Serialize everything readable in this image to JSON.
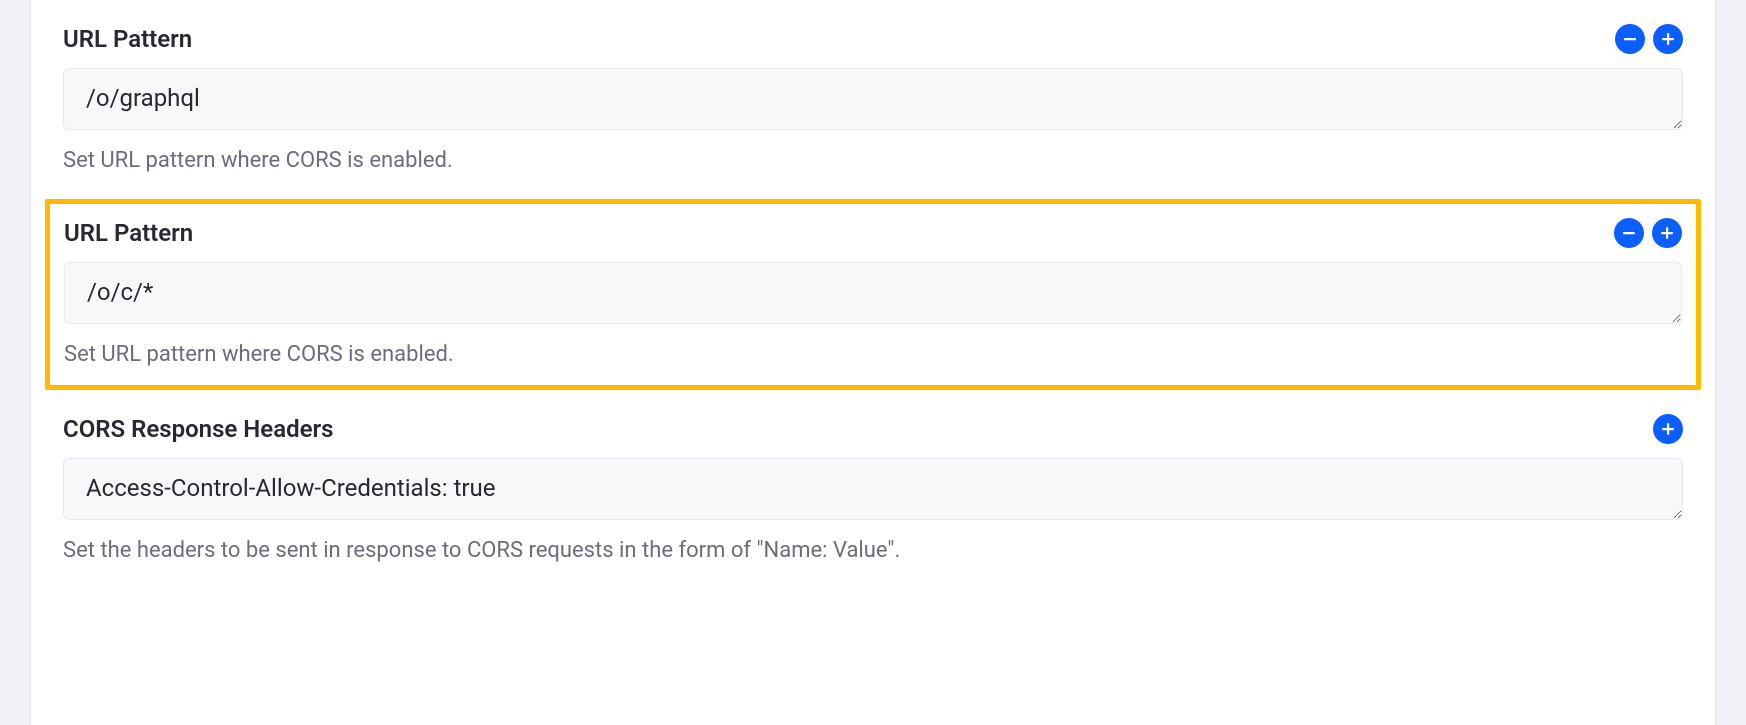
{
  "fields": [
    {
      "label": "URL Pattern",
      "value": "/o/graphql",
      "help": "Set URL pattern where CORS is enabled.",
      "has_remove": true,
      "has_add": true
    },
    {
      "label": "URL Pattern",
      "value": "/o/c/*",
      "help": "Set URL pattern where CORS is enabled.",
      "has_remove": true,
      "has_add": true
    }
  ],
  "cors": {
    "label": "CORS Response Headers",
    "value": "Access-Control-Allow-Credentials: true",
    "help": "Set the headers to be sent in response to CORS requests in the form of \"Name: Value\"."
  }
}
